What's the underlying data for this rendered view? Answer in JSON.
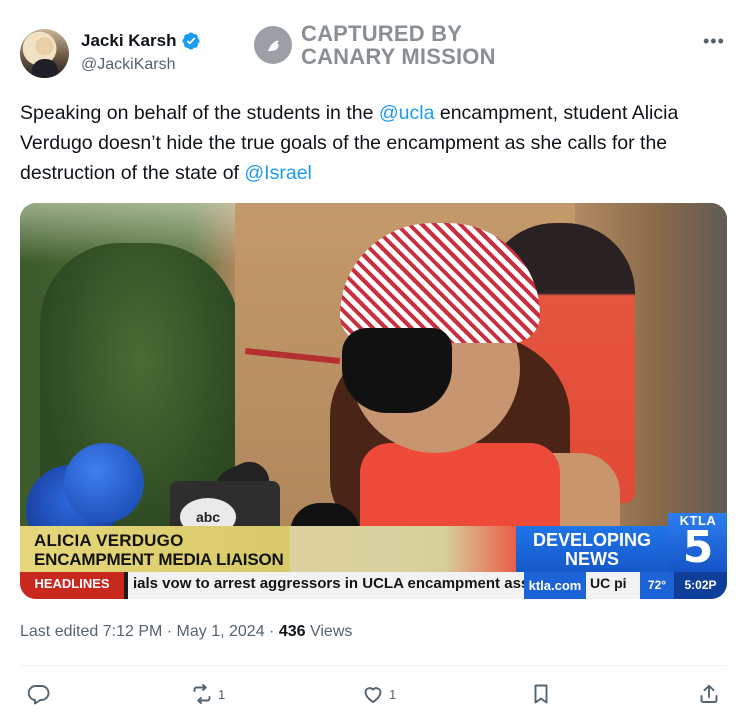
{
  "author": {
    "display_name": "Jacki Karsh",
    "handle": "@JackiKarsh",
    "verified_icon": "verified-badge-icon"
  },
  "watermark": {
    "line1": "CAPTURED BY",
    "line2": "CANARY MISSION"
  },
  "more_label": "•••",
  "tweet": {
    "text_part1": "Speaking on behalf of the students in the ",
    "mention1": "@ucla",
    "text_part2": " encampment, student Alicia Verdugo doesn’t hide the true goals of the encampment as she calls for the destruction of the state of ",
    "mention2": "@Israel",
    "mention_color": "#1d9bf0"
  },
  "media": {
    "caption_name": "ALICIA VERDUGO",
    "caption_title": "ENCAMPMENT MEDIA LIAISON",
    "developing_line1": "DEVELOPING",
    "developing_line2": "NEWS",
    "station_word": "KTLA",
    "station_number": "5",
    "mic_logo": "abc",
    "ticker_label": "HEADLINES",
    "ticker_text": "ials vow to arrest aggressors in UCLA encampment assault",
    "ticker_site": "ktla.com",
    "ticker_extra": "UC pi",
    "ticker_temp": "72°",
    "ticker_time": "5:02P"
  },
  "meta": {
    "edited_prefix": "Last edited ",
    "time": "7:12 PM",
    "sep1": " · ",
    "date": "May 1, 2024",
    "sep2": " · ",
    "views_count": "436",
    "views_label": " Views"
  },
  "actions": {
    "reply_count": "",
    "repost_count": "1",
    "like_count": "1",
    "icons": [
      "reply-icon",
      "repost-icon",
      "like-icon",
      "bookmark-icon",
      "share-icon"
    ]
  }
}
